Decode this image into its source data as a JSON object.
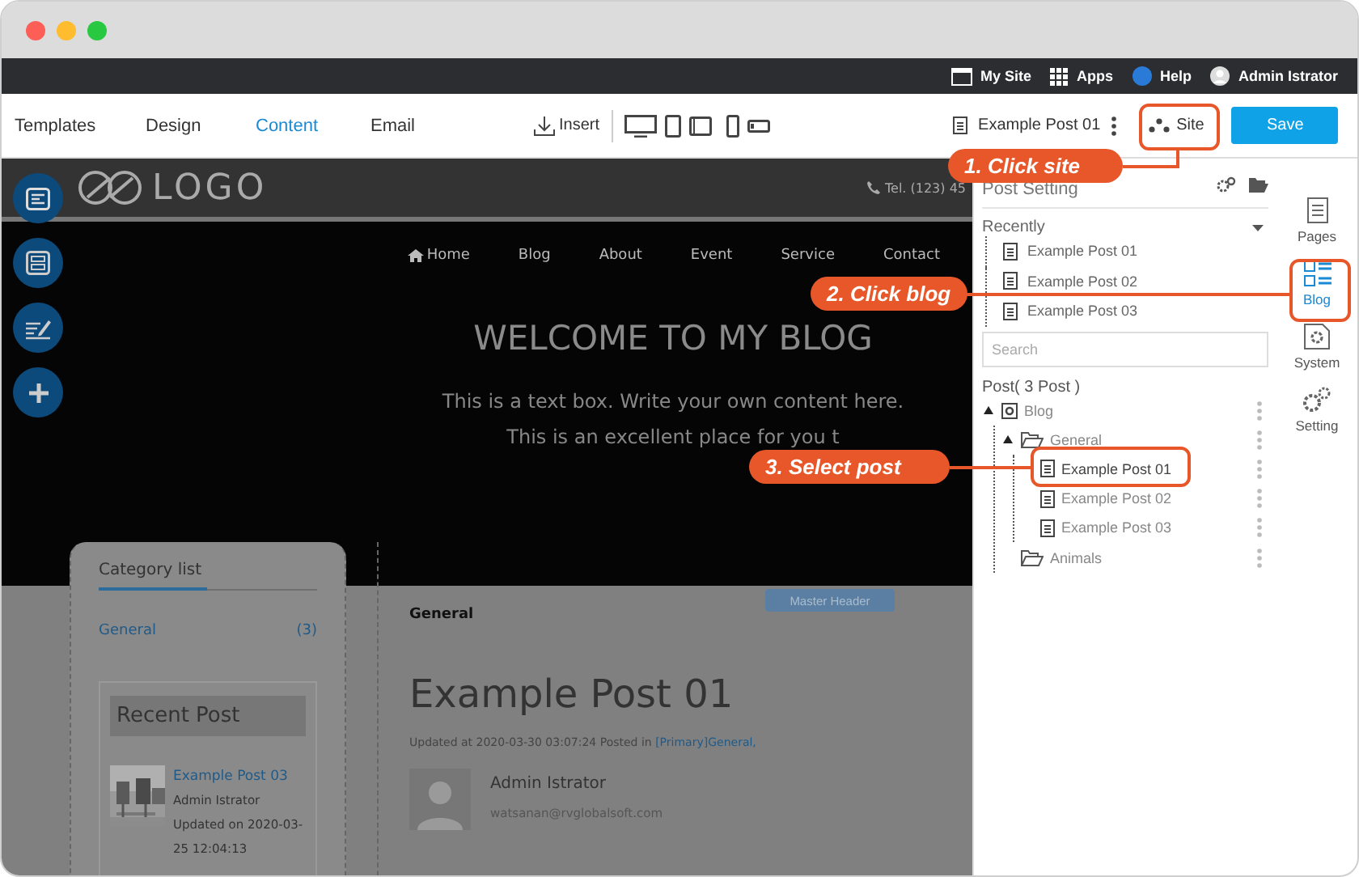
{
  "topbar": {
    "items": [
      {
        "label": "My Site",
        "kind": "window"
      },
      {
        "label": "Apps",
        "kind": "grid"
      },
      {
        "label": "Help",
        "kind": "help"
      },
      {
        "label": "Admin Istrator",
        "kind": "user"
      }
    ]
  },
  "toolbar": {
    "tabs": [
      {
        "label": "Templates",
        "selected": false
      },
      {
        "label": "Design",
        "selected": false
      },
      {
        "label": "Content",
        "selected": true
      },
      {
        "label": "Email",
        "selected": false
      }
    ],
    "insert": "Insert",
    "document": "Example Post 01",
    "site": "Site",
    "save": "Save"
  },
  "site_preview": {
    "logo": "LOGO",
    "phone": "Tel. (123) 45",
    "nav": [
      {
        "label": "Home",
        "kind": "home"
      },
      {
        "label": "Blog",
        "kind": "link"
      },
      {
        "label": "About",
        "kind": "link"
      },
      {
        "label": "Event",
        "kind": "link"
      },
      {
        "label": "Service",
        "kind": "link"
      },
      {
        "label": "Contact",
        "kind": "link"
      }
    ],
    "headline": "WELCOME TO MY BLOG",
    "text_lines": [
      "This is a text box. Write your own content here.",
      "This is an excellent place for you t"
    ],
    "category_list": {
      "title": "Category list",
      "items": [
        {
          "name": "General",
          "count": "(3)"
        }
      ]
    },
    "recent_post": {
      "title": "Recent Post",
      "post": {
        "title": "Example Post 03",
        "author": "Admin Istrator",
        "updated": "Updated on 2020-03-25 12:04:13"
      }
    },
    "post": {
      "category": "General",
      "badge": "Master Header",
      "title": "Example Post 01",
      "meta": "Updated at 2020-03-30 03:07:24 Posted in ",
      "meta_link": "[Primary]General,",
      "author": "Admin Istrator",
      "email": "watsanan@rvglobalsoft.com"
    }
  },
  "post_setting": {
    "title": "Post Setting",
    "recently_label": "Recently",
    "recently": [
      "Example Post 01",
      "Example Post 02",
      "Example Post 03"
    ],
    "search": {
      "placeholder": "Search"
    },
    "tree_heading": "Post( 3 Post )",
    "tree": [
      {
        "label": "Blog",
        "kind": "site",
        "expanded": true,
        "children": [
          {
            "label": "General",
            "kind": "folder",
            "expanded": true,
            "children": [
              {
                "label": "Example Post 01",
                "kind": "post",
                "selected": true
              },
              {
                "label": "Example Post 02",
                "kind": "post",
                "selected": false
              },
              {
                "label": "Example Post 03",
                "kind": "post",
                "selected": false
              }
            ]
          },
          {
            "label": "Animals",
            "kind": "folder",
            "expanded": false
          }
        ]
      }
    ]
  },
  "sidebar": {
    "items": [
      {
        "label": "Pages",
        "selected": false
      },
      {
        "label": "Blog",
        "selected": true
      },
      {
        "label": "System",
        "selected": false
      },
      {
        "label": "Setting",
        "selected": false
      }
    ]
  },
  "annotations": [
    {
      "text": "1. Click site"
    },
    {
      "text": "2. Click blog"
    },
    {
      "text": "3. Select post"
    }
  ]
}
